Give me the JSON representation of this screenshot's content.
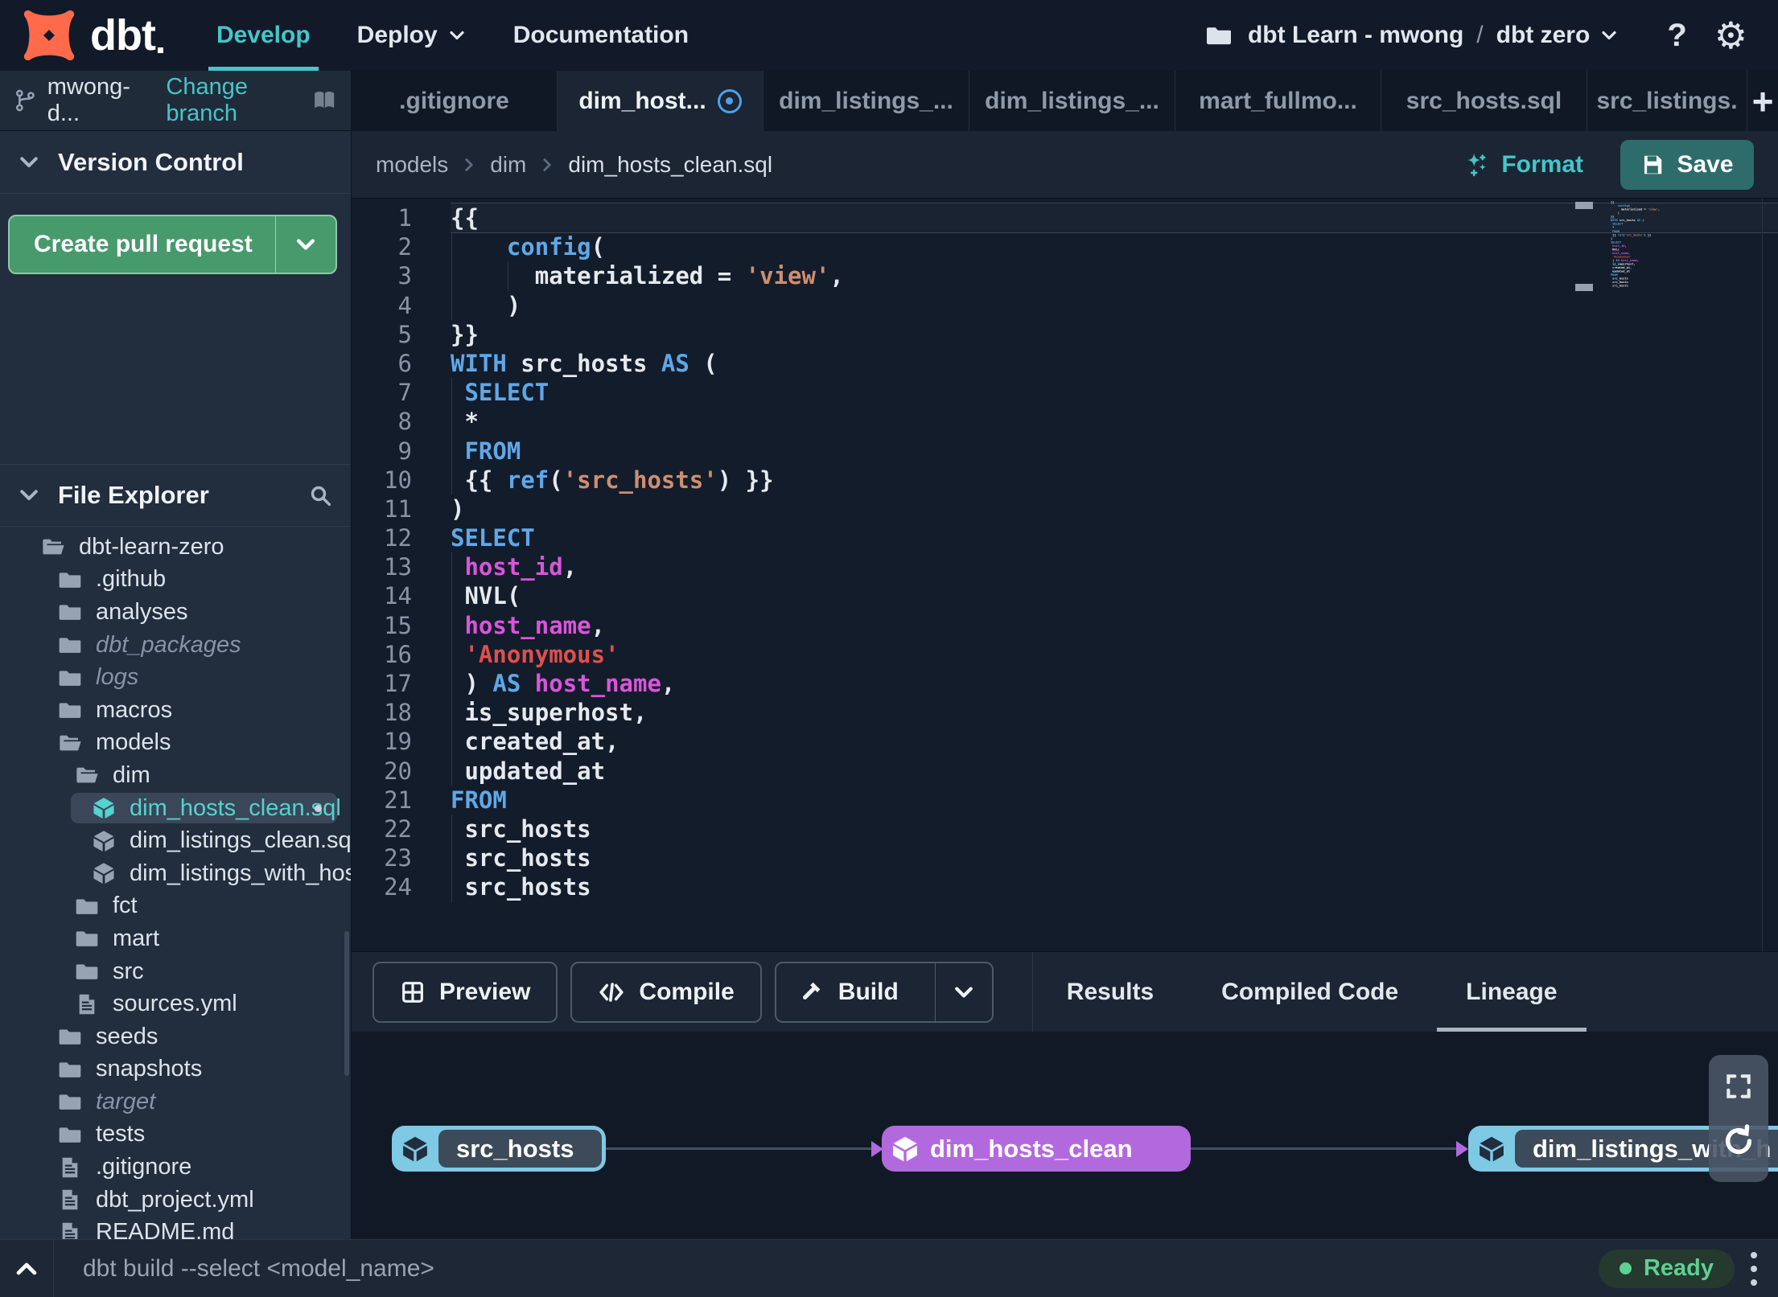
{
  "colors": {
    "accent_teal": "#45c6c9",
    "accent_green": "#479a6c",
    "save_button_teal": "#2d6c6a",
    "node_blue": "#7ec9e4",
    "node_purple": "#b269dd",
    "ready_green": "#5fcf94",
    "modified_blue": "#4ba3e8",
    "code_keyword_blue": "#5fa8e8",
    "code_string_orange": "#cd8e72",
    "code_string_red": "#e04f4f",
    "code_ident_magenta": "#da55da"
  },
  "topnav": {
    "logo_text": "dbt",
    "nav": [
      {
        "label": "Develop"
      },
      {
        "label": "Deploy"
      },
      {
        "label": "Documentation"
      }
    ],
    "project_name": "dbt Learn - mwong",
    "project_separator": "/",
    "environment": "dbt zero",
    "help_label": "?",
    "gear_glyph": "⚙"
  },
  "branch_bar": {
    "branch_name": "mwong-d...",
    "change_branch_label": "Change branch"
  },
  "editor_tabs": {
    "tabs": [
      {
        "label": ".gitignore"
      },
      {
        "label": "dim_host...",
        "active": true,
        "modified": true
      },
      {
        "label": "dim_listings_..."
      },
      {
        "label": "dim_listings_..."
      },
      {
        "label": "mart_fullmo..."
      },
      {
        "label": "src_hosts.sql"
      },
      {
        "label": "src_listings."
      }
    ],
    "add_tab_label": "+"
  },
  "sidebar": {
    "version_control": {
      "title": "Version Control",
      "create_pr_label": "Create pull request"
    },
    "file_explorer": {
      "title": "File Explorer",
      "tree": [
        {
          "label": "dbt-learn-zero",
          "icon": "folder-open",
          "level": 0
        },
        {
          "label": ".github",
          "icon": "folder",
          "level": 1
        },
        {
          "label": "analyses",
          "icon": "folder",
          "level": 1
        },
        {
          "label": "dbt_packages",
          "icon": "folder",
          "level": 1,
          "dim": true
        },
        {
          "label": "logs",
          "icon": "folder",
          "level": 1,
          "dim": true
        },
        {
          "label": "macros",
          "icon": "folder",
          "level": 1
        },
        {
          "label": "models",
          "icon": "folder-open",
          "level": 1
        },
        {
          "label": "dim",
          "icon": "folder-open",
          "level": 2
        },
        {
          "label": "dim_hosts_clean.sql",
          "icon": "model",
          "level": 3,
          "selected": true,
          "modified": true
        },
        {
          "label": "dim_listings_clean.sql",
          "icon": "model",
          "level": 3
        },
        {
          "label": "dim_listings_with_hosts...",
          "icon": "model",
          "level": 3
        },
        {
          "label": "fct",
          "icon": "folder",
          "level": 2
        },
        {
          "label": "mart",
          "icon": "folder",
          "level": 2
        },
        {
          "label": "src",
          "icon": "folder",
          "level": 2
        },
        {
          "label": "sources.yml",
          "icon": "file",
          "level": 2
        },
        {
          "label": "seeds",
          "icon": "folder",
          "level": 1
        },
        {
          "label": "snapshots",
          "icon": "folder",
          "level": 1
        },
        {
          "label": "target",
          "icon": "folder",
          "level": 1,
          "dim": true
        },
        {
          "label": "tests",
          "icon": "folder",
          "level": 1
        },
        {
          "label": ".gitignore",
          "icon": "file",
          "level": 1
        },
        {
          "label": "dbt_project.yml",
          "icon": "file",
          "level": 1
        },
        {
          "label": "README.md",
          "icon": "file",
          "level": 1
        }
      ]
    }
  },
  "breadcrumb": {
    "items": [
      "models",
      "dim",
      "dim_hosts_clean.sql"
    ],
    "format_label": "Format",
    "save_label": "Save"
  },
  "code": {
    "lines": [
      [
        [
          "p",
          "{{"
        ]
      ],
      [
        [
          "p",
          "    "
        ],
        [
          "kw",
          "config"
        ],
        [
          "p",
          "("
        ]
      ],
      [
        [
          "p",
          "      materialized = "
        ],
        [
          "s1",
          "'view'"
        ],
        [
          "p",
          ","
        ]
      ],
      [
        [
          "p",
          "    )"
        ]
      ],
      [
        [
          "p",
          "}}"
        ]
      ],
      [
        [
          "kw",
          "WITH"
        ],
        [
          "p",
          " src_hosts "
        ],
        [
          "kw",
          "AS"
        ],
        [
          "p",
          " ("
        ]
      ],
      [
        [
          "p",
          " "
        ],
        [
          "kw",
          "SELECT"
        ]
      ],
      [
        [
          "p",
          " *"
        ]
      ],
      [
        [
          "p",
          " "
        ],
        [
          "kw",
          "FROM"
        ]
      ],
      [
        [
          "p",
          " {{ "
        ],
        [
          "kw",
          "ref"
        ],
        [
          "p",
          "("
        ],
        [
          "s1",
          "'src_hosts'"
        ],
        [
          "p",
          ") }}"
        ]
      ],
      [
        [
          "p",
          ")"
        ]
      ],
      [
        [
          "kw",
          "SELECT"
        ]
      ],
      [
        [
          "p",
          " "
        ],
        [
          "id",
          "host_id"
        ],
        [
          "p",
          ","
        ]
      ],
      [
        [
          "p",
          " NVL("
        ]
      ],
      [
        [
          "p",
          " "
        ],
        [
          "id",
          "host_name"
        ],
        [
          "p",
          ","
        ]
      ],
      [
        [
          "p",
          " "
        ],
        [
          "s2",
          "'Anonymous'"
        ]
      ],
      [
        [
          "p",
          " ) "
        ],
        [
          "kw",
          "AS"
        ],
        [
          "p",
          " "
        ],
        [
          "id",
          "host_name"
        ],
        [
          "p",
          ","
        ]
      ],
      [
        [
          "p",
          " is_superhost,"
        ]
      ],
      [
        [
          "p",
          " created_at,"
        ]
      ],
      [
        [
          "p",
          " updated_at"
        ]
      ],
      [
        [
          "kw",
          "FROM"
        ]
      ],
      [
        [
          "p",
          " src_hosts"
        ]
      ],
      [
        [
          "p",
          " src_hosts"
        ]
      ],
      [
        [
          "p",
          " src_hosts"
        ]
      ]
    ],
    "guides": {
      "2": [
        0
      ],
      "3": [
        0,
        4
      ],
      "4": [
        0
      ],
      "7": [
        0
      ],
      "8": [
        0
      ],
      "9": [
        0
      ],
      "10": [
        0
      ],
      "13": [
        0
      ],
      "14": [
        0
      ],
      "15": [
        0
      ],
      "16": [
        0
      ],
      "17": [
        0
      ],
      "18": [
        0
      ],
      "19": [
        0
      ],
      "20": [
        0
      ],
      "22": [
        0
      ],
      "23": [
        0
      ],
      "24": [
        0
      ]
    },
    "current_line": 1
  },
  "bottom_panel": {
    "preview_label": "Preview",
    "compile_label": "Compile",
    "build_label": "Build",
    "tabs": [
      {
        "label": "Results"
      },
      {
        "label": "Compiled Code"
      },
      {
        "label": "Lineage",
        "active": true
      }
    ]
  },
  "lineage": {
    "nodes": [
      {
        "label": "src_hosts",
        "style": "blue"
      },
      {
        "label": "dim_hosts_clean",
        "style": "purple"
      },
      {
        "label": "dim_listings_with_h",
        "style": "blue"
      }
    ]
  },
  "command_bar": {
    "command": "dbt build --select <model_name>",
    "status": "Ready"
  }
}
